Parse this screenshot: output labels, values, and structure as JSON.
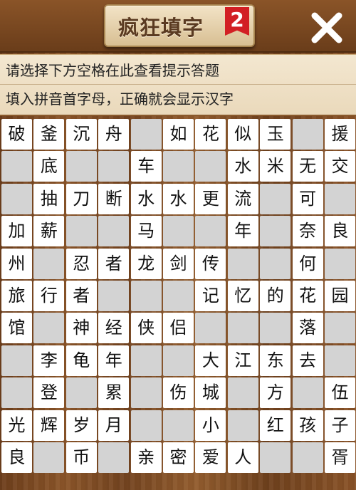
{
  "header": {
    "title": "疯狂填字",
    "level": "2",
    "close_icon": "close-x-icon"
  },
  "hint": {
    "line1": "请选择下方空格在此查看提示答题",
    "line2": "填入拼音首字母，正确就会显示汉字"
  },
  "colors": {
    "wood": "#7a4a22",
    "badge": "#d21f24",
    "filled_cell": "#ffffff",
    "empty_cell": "#d3d3d3"
  },
  "grid": {
    "rows": [
      [
        "破",
        "釜",
        "沉",
        "舟",
        "",
        "如",
        "花",
        "似",
        "玉",
        "",
        "援"
      ],
      [
        "",
        "底",
        "",
        "",
        "车",
        "",
        "",
        "水",
        "米",
        "无",
        "交"
      ],
      [
        "",
        "抽",
        "刀",
        "断",
        "水",
        "水",
        "更",
        "流",
        "",
        "可",
        ""
      ],
      [
        "加",
        "薪",
        "",
        "",
        "马",
        "",
        "",
        "年",
        "",
        "奈",
        "良"
      ],
      [
        "州",
        "",
        "忍",
        "者",
        "龙",
        "剑",
        "传",
        "",
        "",
        "何",
        ""
      ],
      [
        "旅",
        "行",
        "者",
        "",
        "",
        "",
        "记",
        "忆",
        "的",
        "花",
        "园"
      ],
      [
        "馆",
        "",
        "神",
        "经",
        "侠",
        "侣",
        "",
        "",
        "",
        "落",
        ""
      ],
      [
        "",
        "李",
        "龟",
        "年",
        "",
        "",
        "大",
        "江",
        "东",
        "去",
        ""
      ],
      [
        "",
        "登",
        "",
        "累",
        "",
        "伤",
        "城",
        "",
        "方",
        "",
        "伍"
      ],
      [
        "光",
        "辉",
        "岁",
        "月",
        "",
        "",
        "小",
        "",
        "红",
        "孩",
        "子"
      ],
      [
        "良",
        "",
        "币",
        "",
        "亲",
        "密",
        "爱",
        "人",
        "",
        "",
        "胥"
      ]
    ]
  }
}
